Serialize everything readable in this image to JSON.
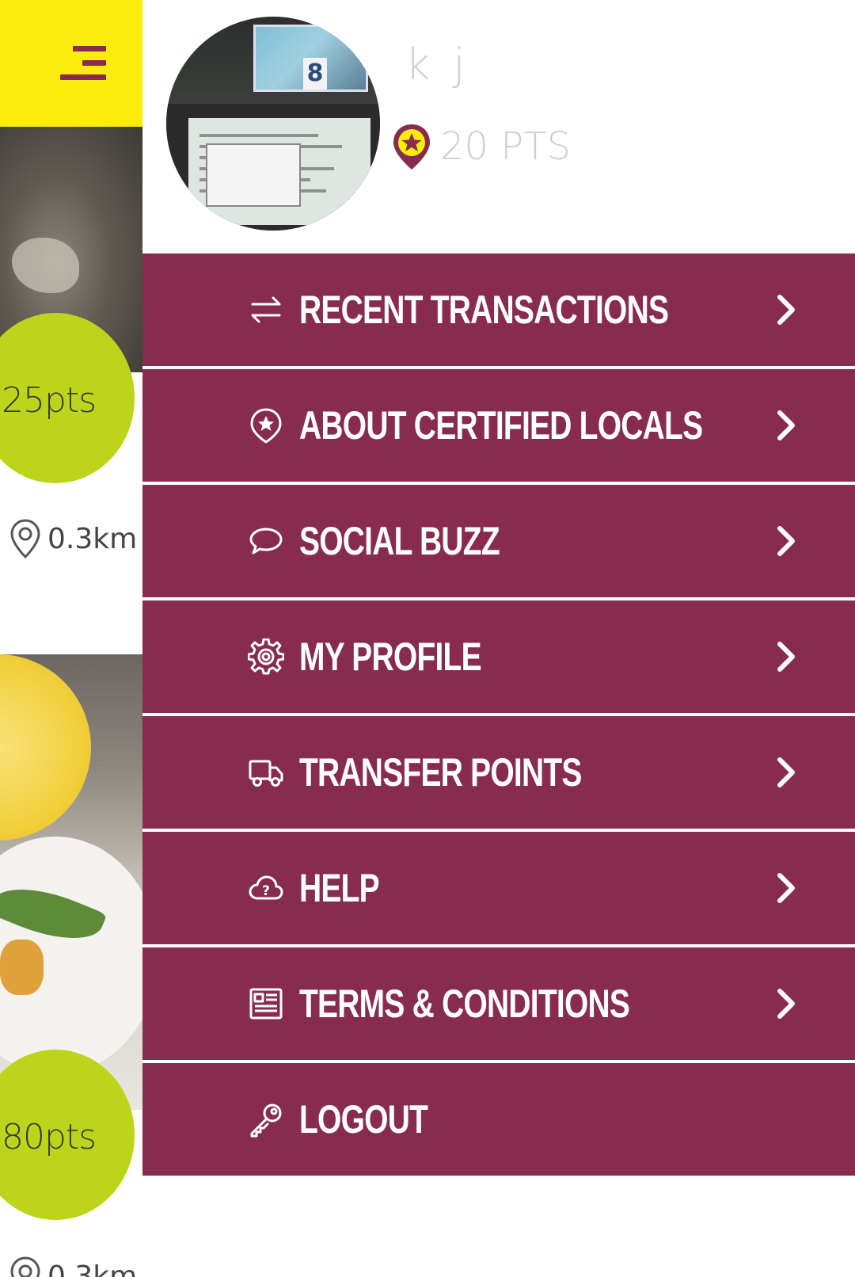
{
  "colors": {
    "accent_yellow": "#fbec0b",
    "menu_bg": "#872b4f",
    "points_bubble": "#bcd41a",
    "muted_text": "#cfcfcf"
  },
  "background_feed": {
    "cards": [
      {
        "points": "25pts",
        "distance": "0.3km"
      },
      {
        "points": "80pts",
        "distance": "0.3km"
      }
    ]
  },
  "profile": {
    "username": "k j",
    "points": "20 PTS",
    "badge_icon": "star-pin-icon"
  },
  "menu": {
    "items": [
      {
        "label": "RECENT TRANSACTIONS",
        "icon": "swap-arrows-icon",
        "chevron": true
      },
      {
        "label": "ABOUT CERTIFIED LOCALS",
        "icon": "star-pin-icon",
        "chevron": true
      },
      {
        "label": "SOCIAL BUZZ",
        "icon": "speech-bubble-icon",
        "chevron": true
      },
      {
        "label": "MY PROFILE",
        "icon": "gear-icon",
        "chevron": true
      },
      {
        "label": "TRANSFER POINTS",
        "icon": "truck-icon",
        "chevron": true
      },
      {
        "label": "HELP",
        "icon": "cloud-question-icon",
        "chevron": true
      },
      {
        "label": "TERMS & CONDITIONS",
        "icon": "document-icon",
        "chevron": true
      },
      {
        "label": "LOGOUT",
        "icon": "key-icon",
        "chevron": false
      }
    ]
  }
}
